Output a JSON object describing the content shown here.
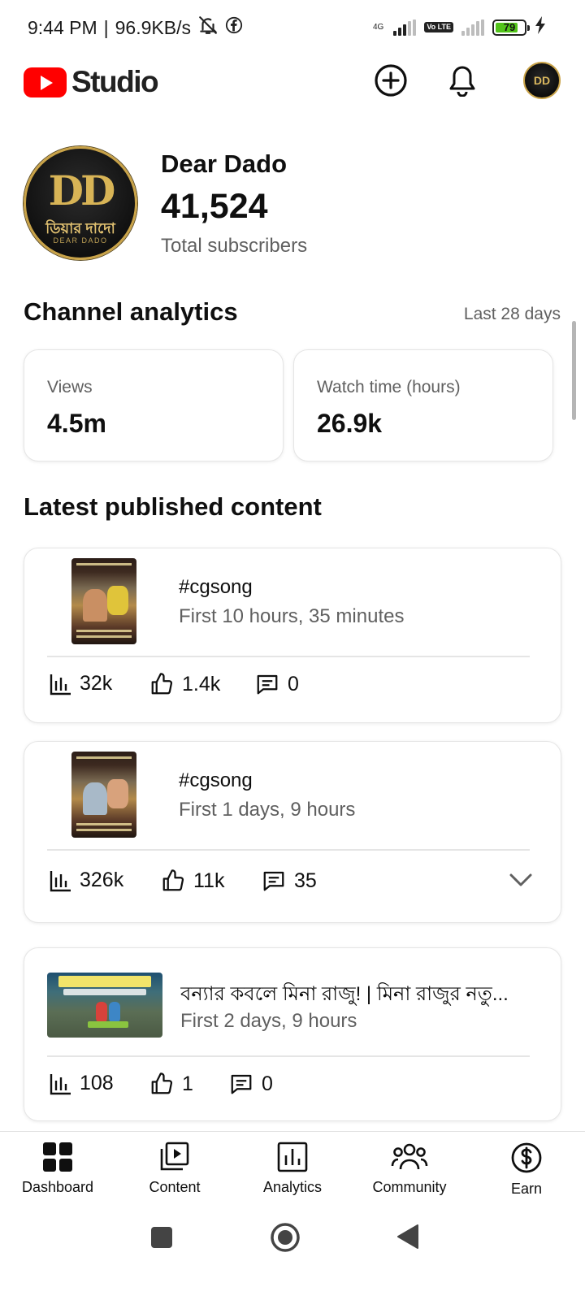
{
  "status_bar": {
    "time": "9:44 PM",
    "separator": "|",
    "speed": "96.9KB/s",
    "network_type": "4G",
    "volte": "Vo LTE",
    "battery": "79"
  },
  "header": {
    "app_name": "Studio",
    "icons": [
      "create-icon",
      "notifications-icon",
      "account-avatar"
    ]
  },
  "channel": {
    "name": "Dear Dado",
    "avatar_monogram": "DD",
    "avatar_bengali": "ডিয়ার দাদো",
    "avatar_english": "DEAR DADO",
    "subscribers": "41,524",
    "subscribers_label": "Total subscribers"
  },
  "analytics": {
    "title": "Channel analytics",
    "period": "Last 28 days",
    "cards": [
      {
        "label": "Views",
        "value": "4.5m"
      },
      {
        "label": "Watch time (hours)",
        "value": "26.9k"
      }
    ]
  },
  "latest": {
    "title": "Latest published content",
    "items": [
      {
        "title": "#cgsong",
        "subtitle": "First 10 hours, 35 minutes",
        "views": "32k",
        "likes": "1.4k",
        "comments": "0"
      },
      {
        "title": "#cgsong",
        "subtitle": "First 1 days, 9 hours",
        "views": "326k",
        "likes": "11k",
        "comments": "35"
      },
      {
        "title": "বন্যার কবলে মিনা রাজু! | মিনা রাজুর নতু...",
        "subtitle": "First 2 days, 9 hours",
        "views": "108",
        "likes": "1",
        "comments": "0"
      }
    ]
  },
  "bottom_nav": [
    {
      "label": "Dashboard",
      "icon": "dashboard-icon",
      "active": true
    },
    {
      "label": "Content",
      "icon": "content-icon",
      "active": false
    },
    {
      "label": "Analytics",
      "icon": "analytics-icon",
      "active": false
    },
    {
      "label": "Community",
      "icon": "community-icon",
      "active": false
    },
    {
      "label": "Earn",
      "icon": "earn-icon",
      "active": false
    }
  ],
  "colors": {
    "brand_red": "#ff0000",
    "text_primary": "#0f0f0f",
    "text_secondary": "#606060",
    "battery_green": "#52c41a",
    "avatar_gold": "#c9a349"
  }
}
